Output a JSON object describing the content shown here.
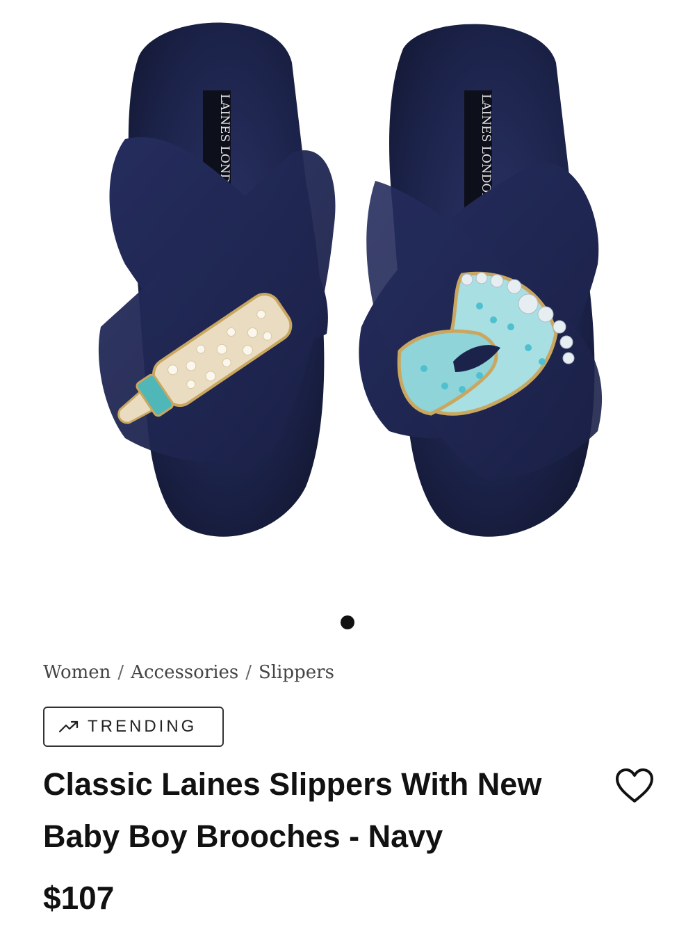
{
  "product_image": {
    "brand_label": "LAINES LONDON",
    "slipper_color": "#1c234a",
    "alt_icon": "slippers-image"
  },
  "carousel": {
    "dots": 1,
    "active_index": 0
  },
  "breadcrumb": {
    "items": [
      "Women",
      "Accessories",
      "Slippers"
    ],
    "separator": "/"
  },
  "badge": {
    "label": "TRENDING",
    "icon": "trending-up-icon"
  },
  "product": {
    "title": "Classic Laines Slippers With New Baby Boy Brooches - Navy",
    "price": "$107"
  },
  "wishlist": {
    "icon": "heart-outline-icon"
  },
  "colors": {
    "text": "#111111",
    "navy": "#1c234a"
  }
}
